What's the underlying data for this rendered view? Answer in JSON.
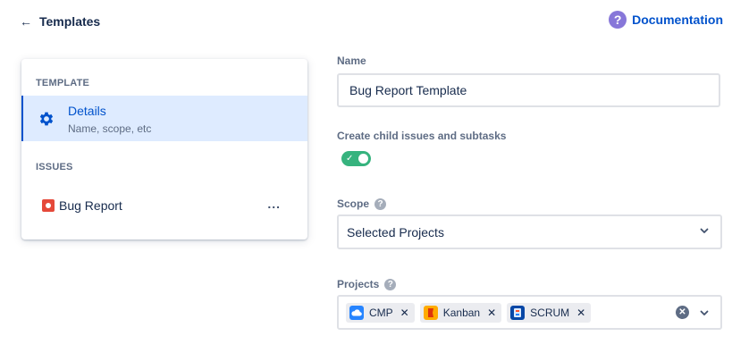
{
  "header": {
    "back_label": "Templates",
    "documentation_label": "Documentation"
  },
  "sidebar": {
    "template_section": "TEMPLATE",
    "details": {
      "title": "Details",
      "subtitle": "Name, scope, etc"
    },
    "issues_section": "ISSUES",
    "issues": [
      {
        "label": "Bug Report",
        "more": "..."
      }
    ]
  },
  "form": {
    "name_label": "Name",
    "name_value": "Bug Report Template",
    "child_issues_label": "Create child issues and subtasks",
    "child_issues_enabled": true,
    "scope_label": "Scope",
    "scope_value": "Selected Projects",
    "projects_label": "Projects",
    "projects": [
      {
        "label": "CMP",
        "icon": "cloud-project-icon"
      },
      {
        "label": "Kanban",
        "icon": "kanban-project-icon"
      },
      {
        "label": "SCRUM",
        "icon": "scrum-project-icon"
      }
    ]
  },
  "colors": {
    "accent": "#0052cc",
    "selected_bg": "#deebff",
    "toggle_on": "#36b37e",
    "bug": "#e5493a",
    "help_purple": "#8777d9"
  }
}
